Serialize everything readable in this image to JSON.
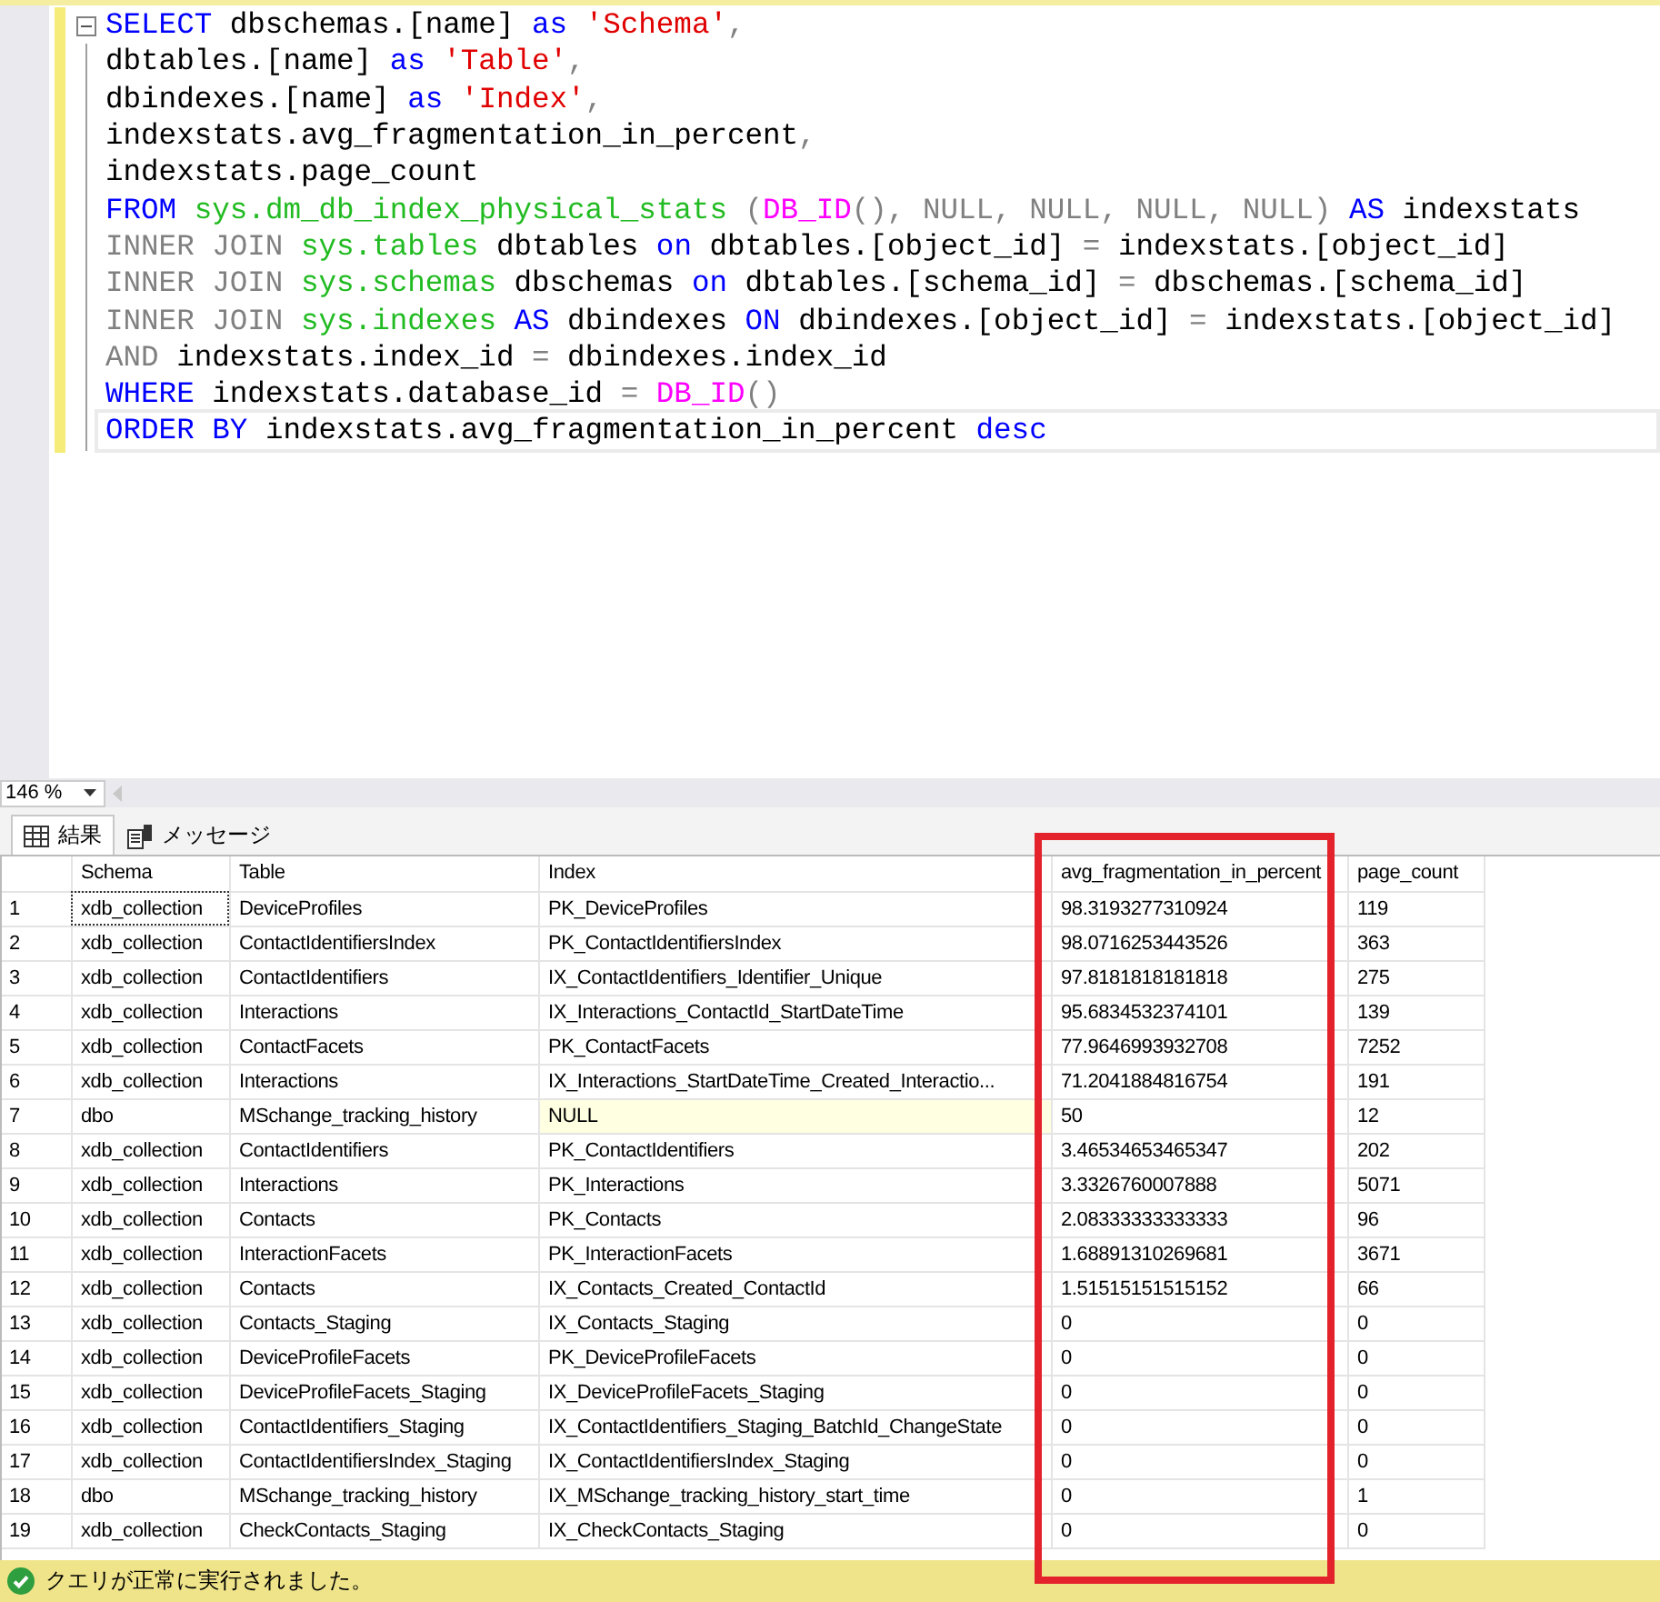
{
  "editor": {
    "lines": [
      {
        "collapse": true,
        "tokens": [
          {
            "kind": "keyword",
            "text": "SELECT"
          },
          {
            "kind": "plain",
            "text": " dbschemas.[name] "
          },
          {
            "kind": "keyword",
            "text": "as"
          },
          {
            "kind": "string",
            "text": " 'Schema'"
          },
          {
            "kind": "operator",
            "text": ","
          }
        ]
      },
      {
        "tokens": [
          {
            "kind": "plain",
            "text": "dbtables.[name] "
          },
          {
            "kind": "keyword",
            "text": "as"
          },
          {
            "kind": "string",
            "text": " 'Table'"
          },
          {
            "kind": "operator",
            "text": ","
          }
        ]
      },
      {
        "tokens": [
          {
            "kind": "plain",
            "text": "dbindexes.[name] "
          },
          {
            "kind": "keyword",
            "text": "as"
          },
          {
            "kind": "string",
            "text": " 'Index'"
          },
          {
            "kind": "operator",
            "text": ","
          }
        ]
      },
      {
        "tokens": [
          {
            "kind": "plain",
            "text": "indexstats.avg_fragmentation_in_percent"
          },
          {
            "kind": "operator",
            "text": ","
          }
        ]
      },
      {
        "tokens": [
          {
            "kind": "plain",
            "text": "indexstats.page_count"
          }
        ]
      },
      {
        "tokens": [
          {
            "kind": "keyword",
            "text": "FROM"
          },
          {
            "kind": "system",
            "text": " sys.dm_db_index_physical_stats"
          },
          {
            "kind": "operator",
            "text": " ("
          },
          {
            "kind": "function",
            "text": "DB_ID"
          },
          {
            "kind": "operator",
            "text": "(), NULL, NULL, NULL, NULL)"
          },
          {
            "kind": "keyword",
            "text": " AS"
          },
          {
            "kind": "plain",
            "text": " indexstats"
          }
        ]
      },
      {
        "tokens": [
          {
            "kind": "operator",
            "text": "INNER JOIN"
          },
          {
            "kind": "system",
            "text": " sys.tables"
          },
          {
            "kind": "plain",
            "text": " dbtables "
          },
          {
            "kind": "keyword",
            "text": "on"
          },
          {
            "kind": "plain",
            "text": " dbtables.[object_id] "
          },
          {
            "kind": "operator",
            "text": "="
          },
          {
            "kind": "plain",
            "text": " indexstats.[object_id]"
          }
        ]
      },
      {
        "tokens": [
          {
            "kind": "operator",
            "text": "INNER JOIN"
          },
          {
            "kind": "system",
            "text": " sys.schemas"
          },
          {
            "kind": "plain",
            "text": " dbschemas "
          },
          {
            "kind": "keyword",
            "text": "on"
          },
          {
            "kind": "plain",
            "text": " dbtables.[schema_id] "
          },
          {
            "kind": "operator",
            "text": "="
          },
          {
            "kind": "plain",
            "text": " dbschemas.[schema_id]"
          }
        ]
      },
      {
        "tokens": [
          {
            "kind": "operator",
            "text": "INNER JOIN"
          },
          {
            "kind": "system",
            "text": " sys.indexes"
          },
          {
            "kind": "keyword",
            "text": " AS"
          },
          {
            "kind": "plain",
            "text": " dbindexes "
          },
          {
            "kind": "keyword",
            "text": "ON"
          },
          {
            "kind": "plain",
            "text": " dbindexes.[object_id] "
          },
          {
            "kind": "operator",
            "text": "="
          },
          {
            "kind": "plain",
            "text": " indexstats.[object_id]"
          }
        ]
      },
      {
        "tokens": [
          {
            "kind": "operator",
            "text": "AND"
          },
          {
            "kind": "plain",
            "text": " indexstats.index_id "
          },
          {
            "kind": "operator",
            "text": "="
          },
          {
            "kind": "plain",
            "text": " dbindexes.index_id"
          }
        ]
      },
      {
        "tokens": [
          {
            "kind": "keyword",
            "text": "WHERE"
          },
          {
            "kind": "plain",
            "text": " indexstats.database_id "
          },
          {
            "kind": "operator",
            "text": "="
          },
          {
            "kind": "function",
            "text": " DB_ID"
          },
          {
            "kind": "operator",
            "text": "()"
          }
        ]
      },
      {
        "current": true,
        "tokens": [
          {
            "kind": "keyword",
            "text": "ORDER BY"
          },
          {
            "kind": "plain",
            "text": " indexstats.avg_fragmentation_in_percent "
          },
          {
            "kind": "keyword",
            "text": "desc"
          }
        ]
      }
    ]
  },
  "zoom": {
    "value": "146 %"
  },
  "tabs": [
    {
      "label": "結果",
      "kind": "grid",
      "selected": true
    },
    {
      "label": "メッセージ",
      "kind": "messages",
      "selected": false
    }
  ],
  "table": {
    "columns": [
      {
        "label": "Schema",
        "highlighted": false
      },
      {
        "label": "Table",
        "highlighted": false
      },
      {
        "label": "Index",
        "highlighted": false
      },
      {
        "label": "avg_fragmentation_in_percent",
        "highlighted": true
      },
      {
        "label": "page_count",
        "highlighted": false
      }
    ],
    "rows": [
      {
        "num": "1",
        "focused": true,
        "cells": [
          "xdb_collection",
          "DeviceProfiles",
          "PK_DeviceProfiles",
          "98.3193277310924",
          "119"
        ]
      },
      {
        "num": "2",
        "cells": [
          "xdb_collection",
          "ContactIdentifiersIndex",
          "PK_ContactIdentifiersIndex",
          "98.0716253443526",
          "363"
        ]
      },
      {
        "num": "3",
        "cells": [
          "xdb_collection",
          "ContactIdentifiers",
          "IX_ContactIdentifiers_Identifier_Unique",
          "97.8181818181818",
          "275"
        ]
      },
      {
        "num": "4",
        "cells": [
          "xdb_collection",
          "Interactions",
          "IX_Interactions_ContactId_StartDateTime",
          "95.6834532374101",
          "139"
        ]
      },
      {
        "num": "5",
        "cells": [
          "xdb_collection",
          "ContactFacets",
          "PK_ContactFacets",
          "77.9646993932708",
          "7252"
        ]
      },
      {
        "num": "6",
        "cells": [
          "xdb_collection",
          "Interactions",
          "IX_Interactions_StartDateTime_Created_Interactio...",
          "71.2041884816754",
          "191"
        ]
      },
      {
        "num": "7",
        "null_index": true,
        "cells": [
          "dbo",
          "MSchange_tracking_history",
          "NULL",
          "50",
          "12"
        ]
      },
      {
        "num": "8",
        "cells": [
          "xdb_collection",
          "ContactIdentifiers",
          "PK_ContactIdentifiers",
          "3.46534653465347",
          "202"
        ]
      },
      {
        "num": "9",
        "cells": [
          "xdb_collection",
          "Interactions",
          "PK_Interactions",
          "3.3326760007888",
          "5071"
        ]
      },
      {
        "num": "10",
        "cells": [
          "xdb_collection",
          "Contacts",
          "PK_Contacts",
          "2.08333333333333",
          "96"
        ]
      },
      {
        "num": "11",
        "cells": [
          "xdb_collection",
          "InteractionFacets",
          "PK_InteractionFacets",
          "1.68891310269681",
          "3671"
        ]
      },
      {
        "num": "12",
        "cells": [
          "xdb_collection",
          "Contacts",
          "IX_Contacts_Created_ContactId",
          "1.51515151515152",
          "66"
        ]
      },
      {
        "num": "13",
        "cells": [
          "xdb_collection",
          "Contacts_Staging",
          "IX_Contacts_Staging",
          "0",
          "0"
        ]
      },
      {
        "num": "14",
        "cells": [
          "xdb_collection",
          "DeviceProfileFacets",
          "PK_DeviceProfileFacets",
          "0",
          "0"
        ]
      },
      {
        "num": "15",
        "cells": [
          "xdb_collection",
          "DeviceProfileFacets_Staging",
          "IX_DeviceProfileFacets_Staging",
          "0",
          "0"
        ]
      },
      {
        "num": "16",
        "cells": [
          "xdb_collection",
          "ContactIdentifiers_Staging",
          "IX_ContactIdentifiers_Staging_BatchId_ChangeState",
          "0",
          "0"
        ]
      },
      {
        "num": "17",
        "cells": [
          "xdb_collection",
          "ContactIdentifiersIndex_Staging",
          "IX_ContactIdentifiersIndex_Staging",
          "0",
          "0"
        ]
      },
      {
        "num": "18",
        "cells": [
          "dbo",
          "MSchange_tracking_history",
          "IX_MSchange_tracking_history_start_time",
          "0",
          "1"
        ]
      },
      {
        "num": "19",
        "cells": [
          "xdb_collection",
          "CheckContacts_Staging",
          "IX_CheckContacts_Staging",
          "0",
          "0"
        ]
      }
    ]
  },
  "status_bar": {
    "kind": "success",
    "message": "クエリが正常に実行されました。"
  }
}
